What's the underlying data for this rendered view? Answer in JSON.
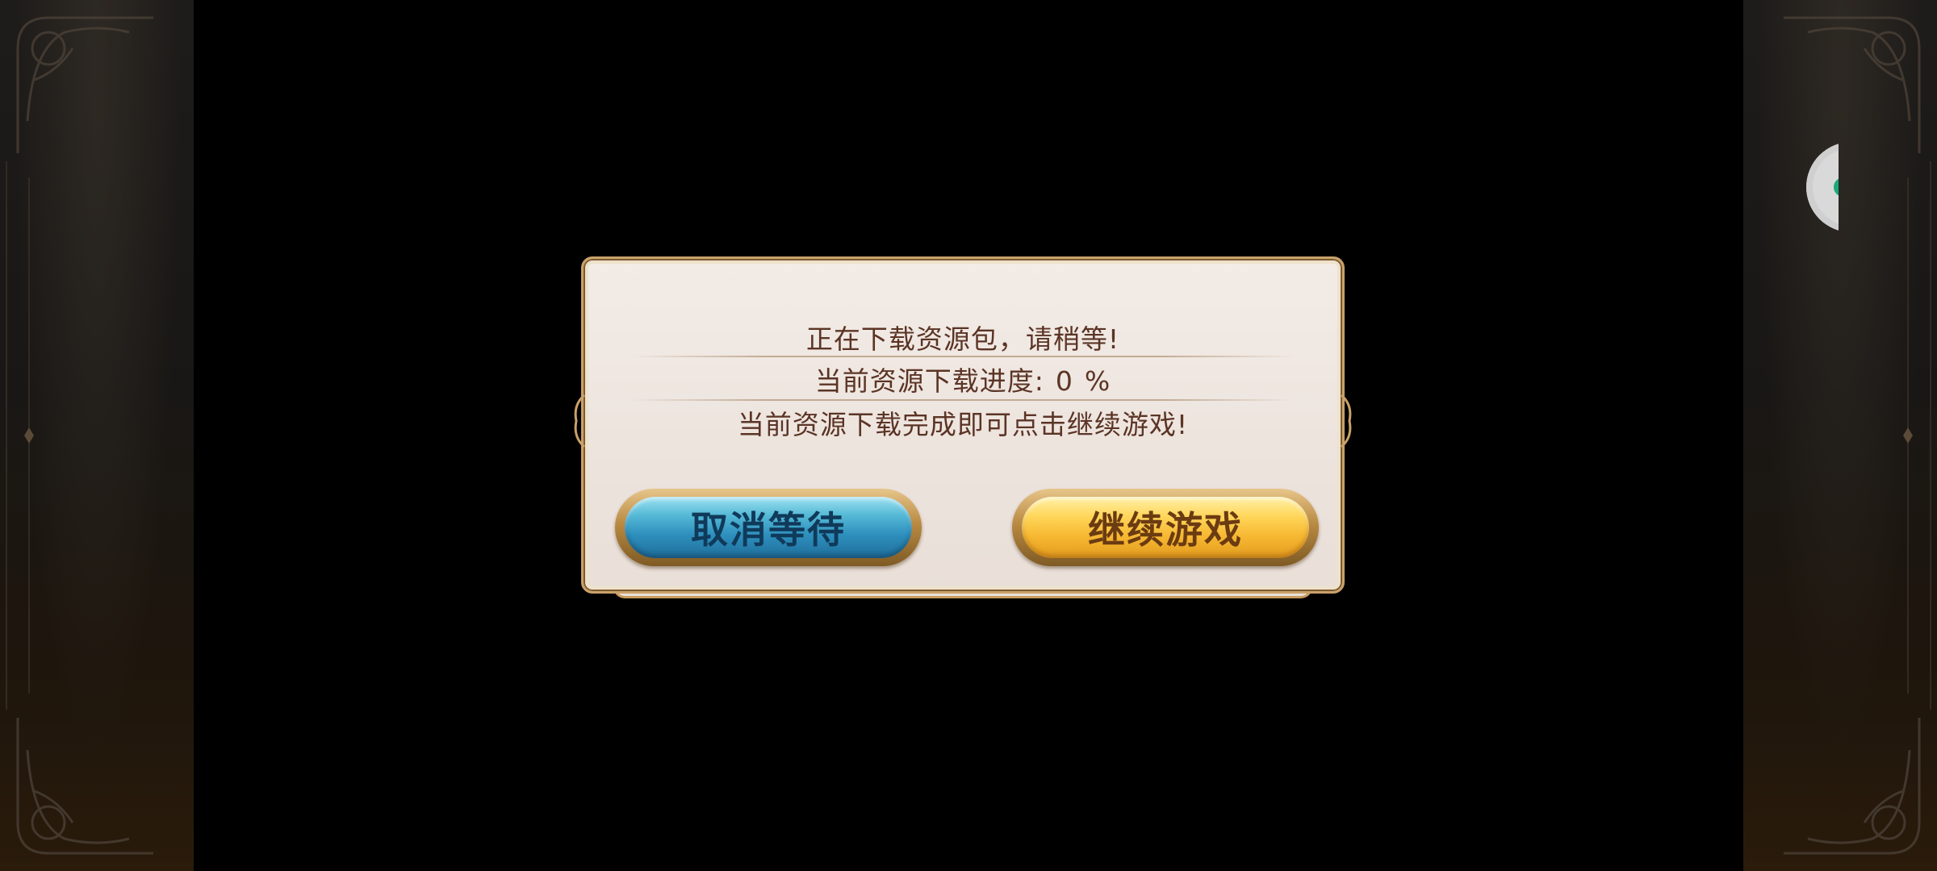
{
  "dialog": {
    "line1": "正在下载资源包，请稍等!",
    "line2_prefix": "当前资源下载进度:",
    "progress_value": "0",
    "progress_unit": "%",
    "line3": "当前资源下载完成即可点击继续游戏!"
  },
  "buttons": {
    "cancel_label": "取消等待",
    "continue_label": "继续游戏"
  },
  "icons": {
    "floating": "assistant-bubble-icon"
  },
  "colors": {
    "text": "#5b3425",
    "cancel_button": "#2e8fbd",
    "continue_button": "#f6b731",
    "frame_gold": "#caa16a",
    "panel_bg": "#ede4de"
  }
}
